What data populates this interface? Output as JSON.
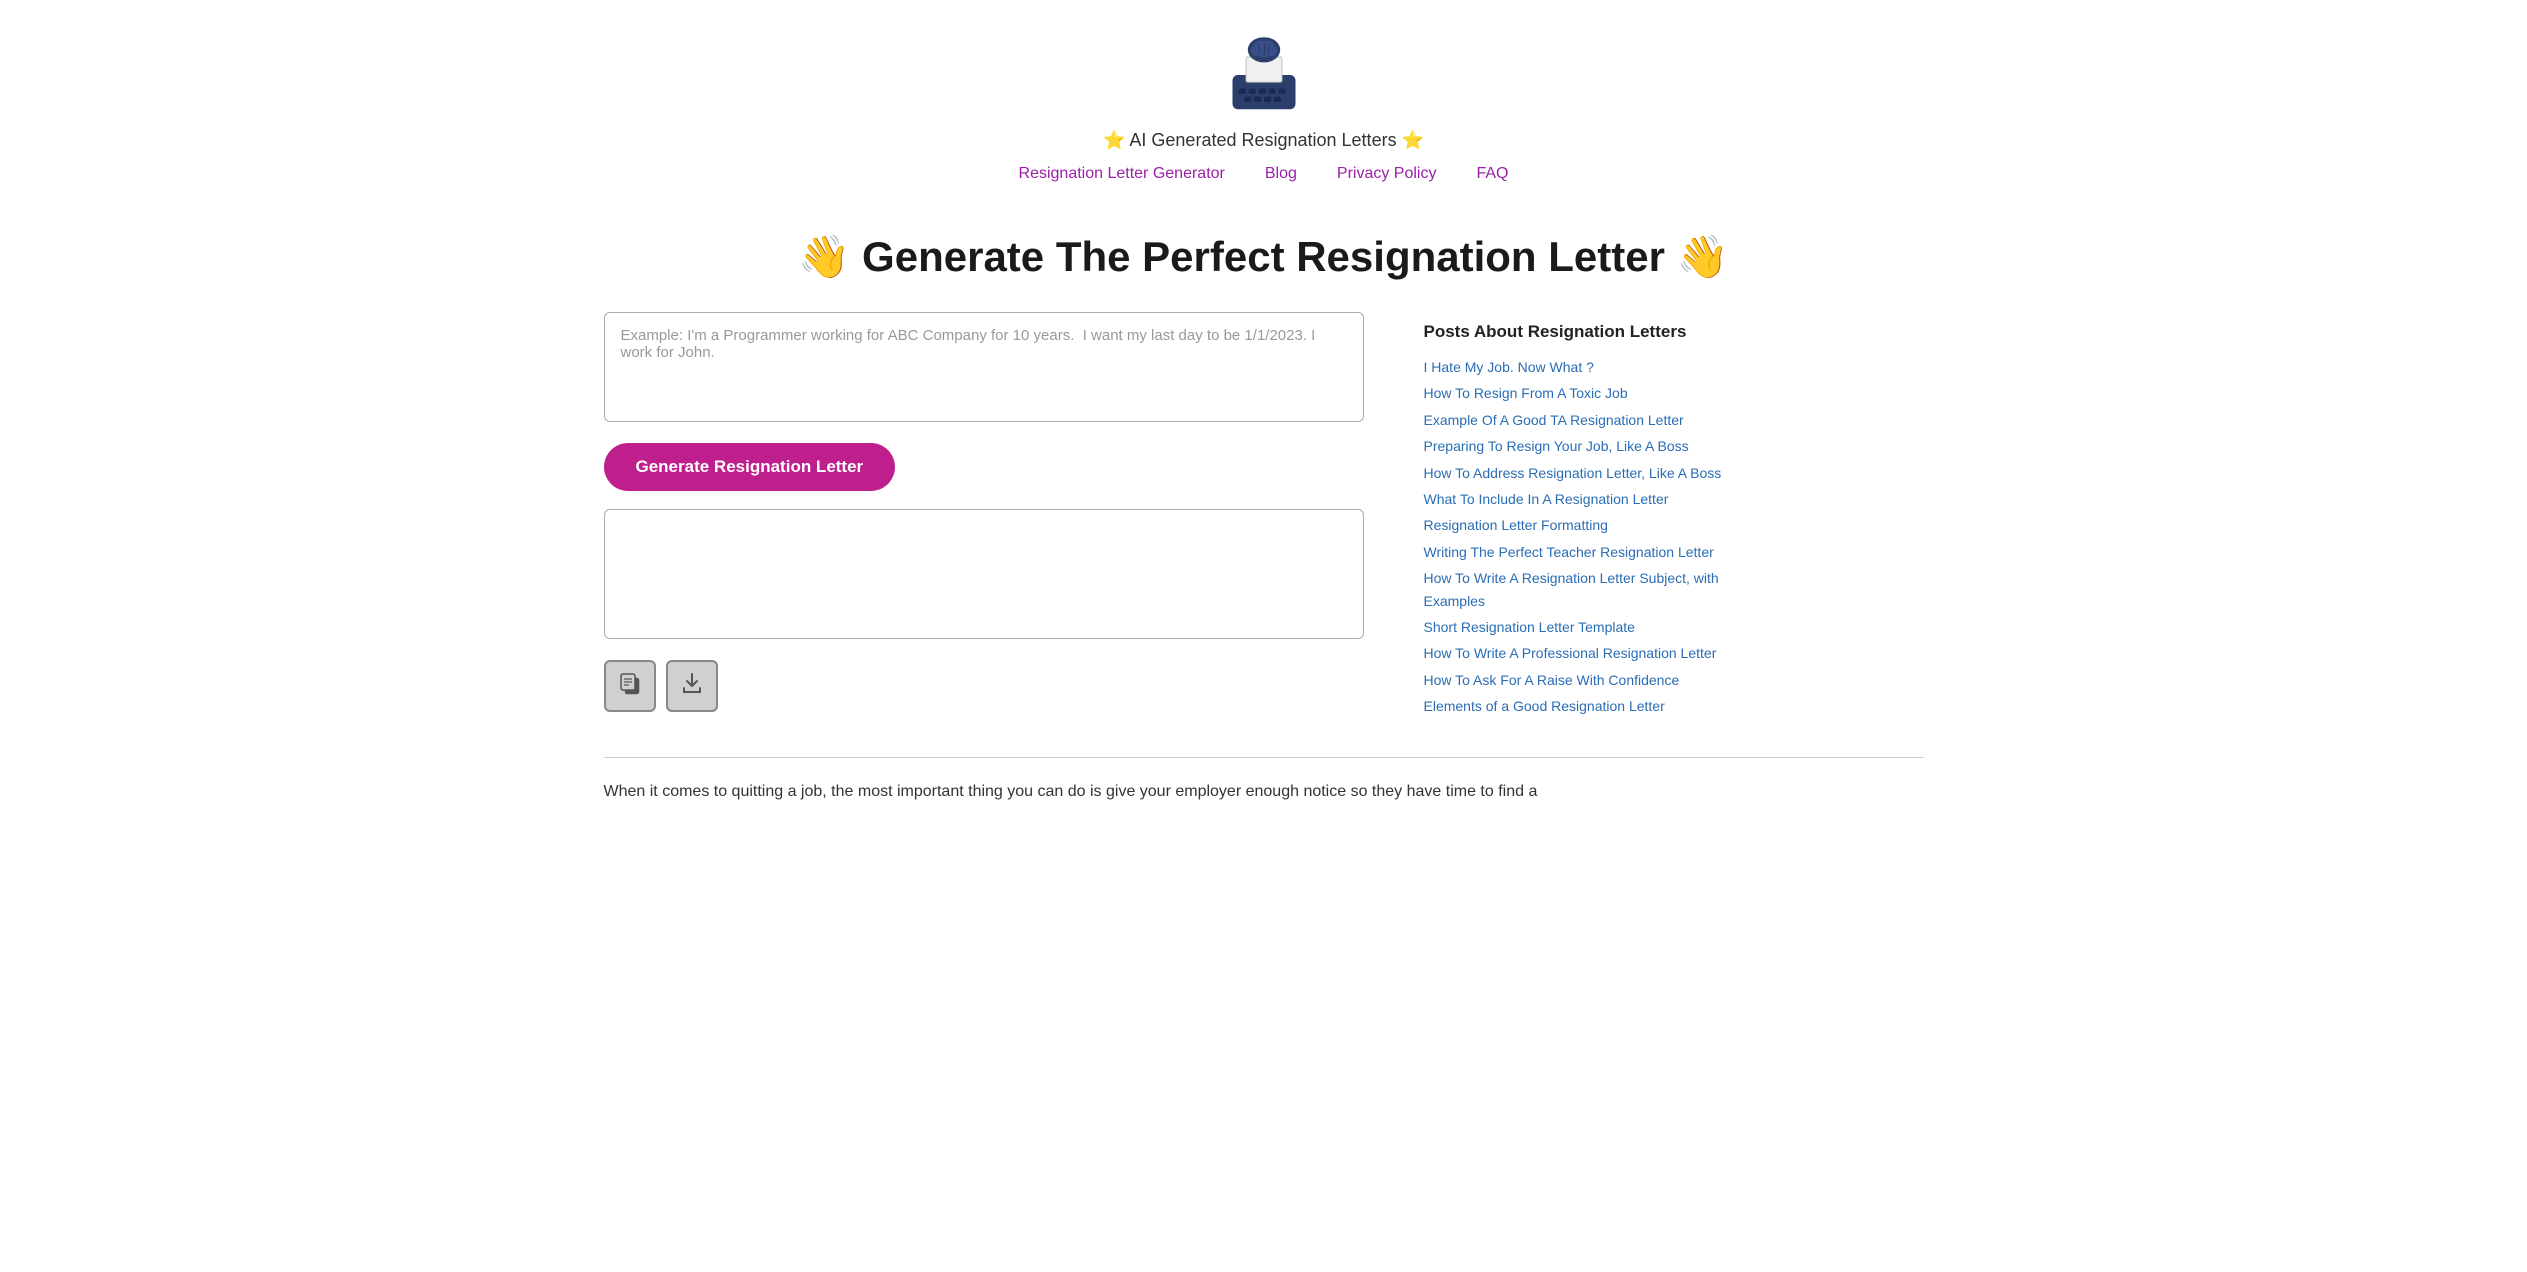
{
  "header": {
    "site_title_prefix": "⭐",
    "site_title_text": "AI Generated Resignation Letters",
    "site_title_suffix": "⭐",
    "nav": [
      {
        "label": "Resignation Letter Generator",
        "href": "#"
      },
      {
        "label": "Blog",
        "href": "#"
      },
      {
        "label": "Privacy Policy",
        "href": "#"
      },
      {
        "label": "FAQ",
        "href": "#"
      }
    ]
  },
  "page_title": "👋 Generate The Perfect Resignation Letter 👋",
  "input": {
    "placeholder": "Example: I'm a Programmer working for ABC Company for 10 years.  I want my last day to be 1/1/2023. I work for John."
  },
  "generate_button_label": "Generate Resignation Letter",
  "output": {
    "placeholder": ""
  },
  "action_buttons": [
    {
      "name": "copy-button",
      "icon": "📋"
    },
    {
      "name": "download-button",
      "icon": "📥"
    }
  ],
  "sidebar": {
    "title": "Posts About Resignation Letters",
    "links": [
      {
        "label": "I Hate My Job. Now What ?",
        "href": "#"
      },
      {
        "label": "How To Resign From A Toxic Job",
        "href": "#"
      },
      {
        "label": "Example Of A Good TA Resignation Letter",
        "href": "#"
      },
      {
        "label": "Preparing To Resign Your Job, Like A Boss",
        "href": "#"
      },
      {
        "label": "How To Address Resignation Letter, Like A Boss",
        "href": "#"
      },
      {
        "label": "What To Include In A Resignation Letter",
        "href": "#"
      },
      {
        "label": "Resignation Letter Formatting",
        "href": "#"
      },
      {
        "label": "Writing The Perfect Teacher Resignation Letter",
        "href": "#"
      },
      {
        "label": "How To Write A Resignation Letter Subject, with Examples",
        "href": "#"
      },
      {
        "label": "Short Resignation Letter Template",
        "href": "#"
      },
      {
        "label": "How To Write A Professional Resignation Letter",
        "href": "#"
      },
      {
        "label": "How To Ask For A Raise With Confidence",
        "href": "#"
      },
      {
        "label": "Elements of a Good Resignation Letter",
        "href": "#"
      }
    ]
  },
  "bottom_text": "When it comes to quitting a job, the most important thing you can do is give your employer enough notice so they have time to find a"
}
